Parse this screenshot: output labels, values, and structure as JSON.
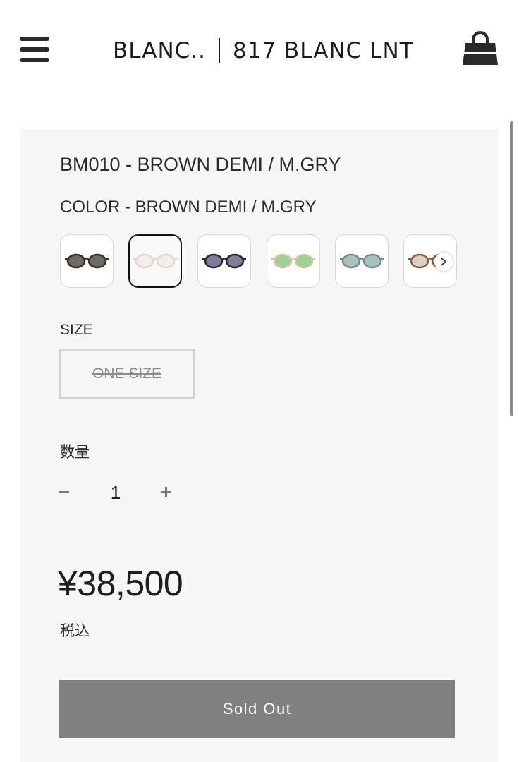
{
  "header": {
    "brand_left": "BLANC..",
    "brand_right": "817 BLANC LNT",
    "menu_icon": "hamburger-menu-icon",
    "cart_icon": "shopping-bag-icon"
  },
  "product": {
    "title": "BM010 - BROWN DEMI / M.GRY",
    "color_label": "COLOR - BROWN DEMI / M.GRY",
    "swatches": [
      {
        "frame": "#3a2e28",
        "lens": "#6e6a64"
      },
      {
        "frame": "#e6d6d0",
        "lens": "#f2ecea",
        "selected": true
      },
      {
        "frame": "#2f2427",
        "lens": "#7b7f9c"
      },
      {
        "frame": "#d4c79c",
        "lens": "#9fd09a"
      },
      {
        "frame": "#7d8a8a",
        "lens": "#a9c2bd"
      },
      {
        "frame": "#8a5a3c",
        "lens": "#d9d0c8"
      }
    ],
    "size_label": "SIZE",
    "size_option": "ONE SIZE",
    "quantity_label": "数量",
    "quantity_value": "1",
    "price": "¥38,500",
    "tax_note": "税込",
    "button_label": "Sold Out"
  },
  "colors": {
    "panel_bg": "#f6f6f6",
    "button_bg": "#808080",
    "text": "#2b2b2b"
  }
}
